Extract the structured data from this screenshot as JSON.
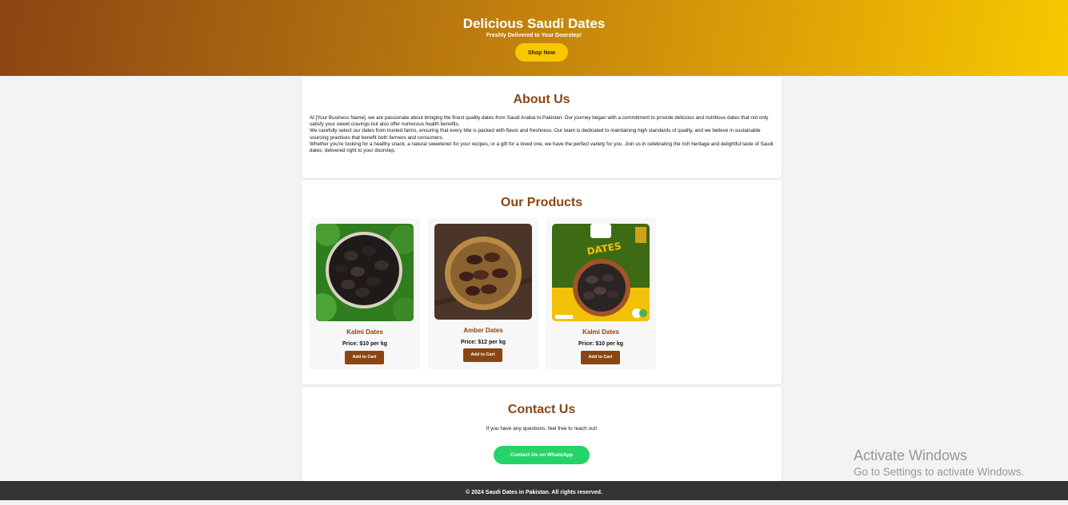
{
  "hero": {
    "title": "Delicious Saudi Dates",
    "subtitle": "Freshly Delivered to Your Doorstep!",
    "button": "Shop Now"
  },
  "about": {
    "heading": "About Us",
    "paragraphs": [
      "At [Your Business Name], we are passionate about bringing the finest quality dates from Saudi Arabia to Pakistan. Our journey began with a commitment to provide delicious and nutritious dates that not only satisfy your sweet cravings but also offer numerous health benefits.",
      "We carefully select our dates from trusted farms, ensuring that every bite is packed with flavor and freshness. Our team is dedicated to maintaining high standards of quality, and we believe in sustainable sourcing practices that benefit both farmers and consumers.",
      "Whether you're looking for a healthy snack, a natural sweetener for your recipes, or a gift for a loved one, we have the perfect variety for you. Join us in celebrating the rich heritage and delightful taste of Saudi dates, delivered right to your doorstep."
    ]
  },
  "products": {
    "heading": "Our Products",
    "items": [
      {
        "name": "Kalmi Dates",
        "price": "Price: $10 per kg",
        "button": "Add to Cart"
      },
      {
        "name": "Amber Dates",
        "price": "Price: $12 per kg",
        "button": "Add to Cart"
      },
      {
        "name": "Kalmi Dates",
        "price": "Price: $10 per kg",
        "button": "Add to Cart",
        "badge": "DATES"
      }
    ]
  },
  "contact": {
    "heading": "Contact Us",
    "message": "If you have any questions, feel free to reach out!",
    "button": "Contact Us on WhatsApp"
  },
  "footer": {
    "text": "© 2024 Saudi Dates in Pakistan. All rights reserved."
  },
  "watermark": {
    "line1": "Activate Windows",
    "line2": "Go to Settings to activate Windows."
  },
  "colors": {
    "brown": "#8b4513",
    "gold": "#f8c800",
    "whatsapp": "#25d366",
    "footer_bg": "#333333"
  }
}
